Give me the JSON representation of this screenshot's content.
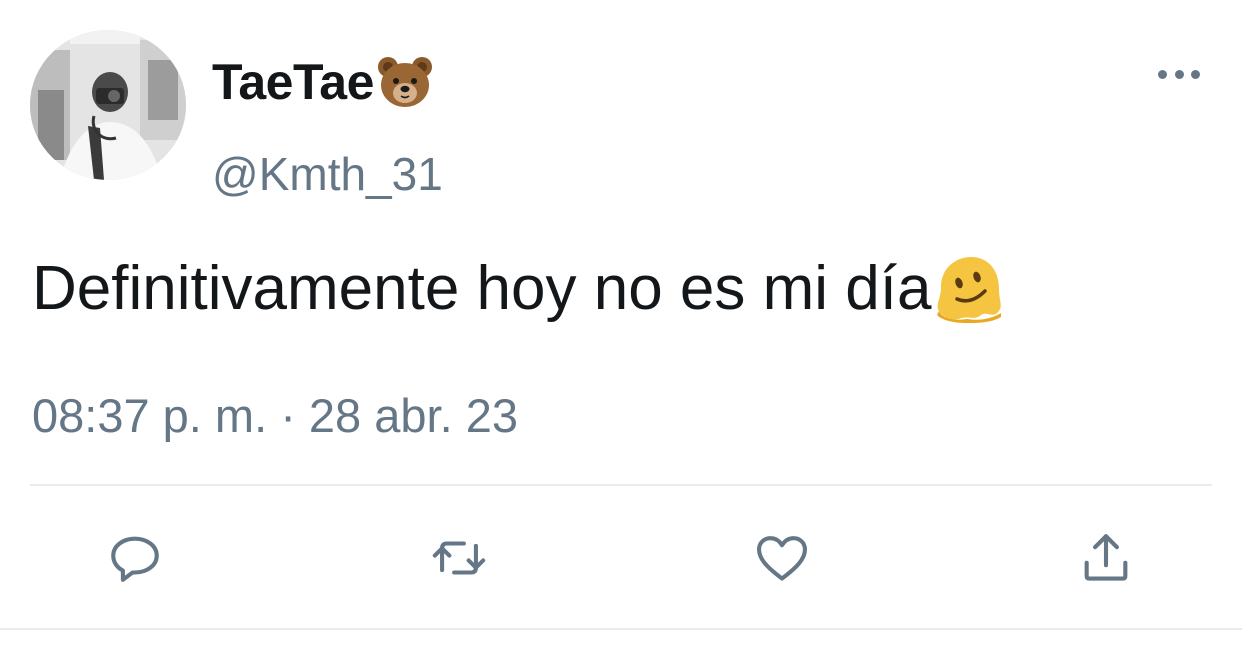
{
  "tweet": {
    "display_name": "TaeTae",
    "display_name_emoji": "bear-face-emoji",
    "handle": "@Kmth_31",
    "text": "Definitivamente hoy no es mi día",
    "text_emoji": "melting-face-emoji",
    "timestamp": "08:37 p. m. · 28 abr. 23"
  },
  "actions": {
    "reply_icon": "reply-icon",
    "retweet_icon": "retweet-icon",
    "like_icon": "heart-icon",
    "share_icon": "share-icon"
  },
  "colors": {
    "primary_text": "#14171a",
    "secondary_text": "#657786",
    "divider": "#e6ecf0",
    "background": "#ffffff"
  }
}
